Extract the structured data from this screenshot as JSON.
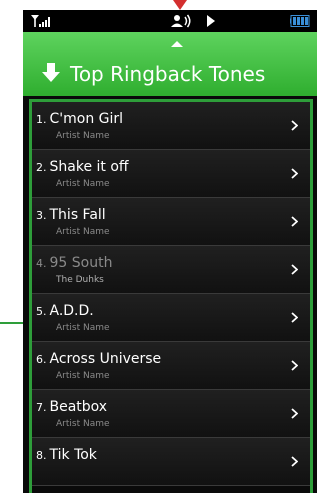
{
  "header": {
    "title": "Top Ringback Tones"
  },
  "colors": {
    "accent": "#3cb43c",
    "annotation": "#2e9e3a",
    "pointer": "#d32f2f"
  },
  "icons": [
    "signal-icon",
    "headset-icon",
    "play-icon",
    "battery-icon",
    "download-arrow-icon",
    "chevron-right-icon"
  ],
  "list": {
    "items": [
      {
        "num": "1.",
        "title": "C'mon Girl",
        "subtitle": "Artist Name"
      },
      {
        "num": "2.",
        "title": "Shake it off",
        "subtitle": "Artist Name"
      },
      {
        "num": "3.",
        "title": "This Fall",
        "subtitle": "Artist Name"
      },
      {
        "num": "4.",
        "title": "95 South",
        "subtitle": "The Duhks"
      },
      {
        "num": "5.",
        "title": "A.D.D.",
        "subtitle": "Artist Name"
      },
      {
        "num": "6.",
        "title": "Across Universe",
        "subtitle": "Artist Name"
      },
      {
        "num": "7.",
        "title": "Beatbox",
        "subtitle": "Artist Name"
      },
      {
        "num": "8.",
        "title": "Tik Tok",
        "subtitle": ""
      }
    ]
  }
}
